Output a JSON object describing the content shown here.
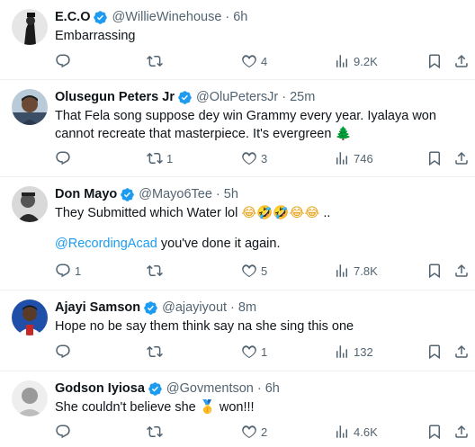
{
  "colors": {
    "accent": "#1d9bf0",
    "secondary_text": "#536471",
    "divider": "#eff3f4"
  },
  "tweets": [
    {
      "name": "E.C.O",
      "handle": "@WillieWinehouse",
      "separator": "·",
      "time": "6h",
      "text": "Embarrassing",
      "replies": "",
      "retweets": "",
      "likes": "4",
      "views": "9.2K"
    },
    {
      "name": "Olusegun Peters Jr",
      "handle": "@OluPetersJr",
      "separator": "·",
      "time": "25m",
      "text": "That Fela song suppose dey win Grammy every year. Iyalaya won cannot recreate that masterpiece. It's evergreen",
      "emoji": "🌲",
      "replies": "",
      "retweets": "1",
      "likes": "3",
      "views": "746"
    },
    {
      "name": "Don Mayo",
      "handle": "@Mayo6Tee",
      "separator": "·",
      "time": "5h",
      "text": "They Submitted which Water lol",
      "emoji": "😂🤣🤣😂😂",
      "text_suffix": "..",
      "mention": "@RecordingAcad",
      "mention_text": "you've done it again.",
      "replies": "1",
      "retweets": "",
      "likes": "5",
      "views": "7.8K"
    },
    {
      "name": "Ajayi Samson",
      "handle": "@ajayiyout",
      "separator": "·",
      "time": "8m",
      "text": "Hope no be say them think say na she sing this one",
      "replies": "",
      "retweets": "",
      "likes": "1",
      "views": "132"
    },
    {
      "name": "Godson Iyiosa",
      "handle": "@Govmentson",
      "separator": "·",
      "time": "6h",
      "text": "She couldn't believe she",
      "emoji": "🥇",
      "text_suffix": "won!!!",
      "replies": "",
      "retweets": "",
      "likes": "2",
      "views": "4.6K"
    }
  ]
}
